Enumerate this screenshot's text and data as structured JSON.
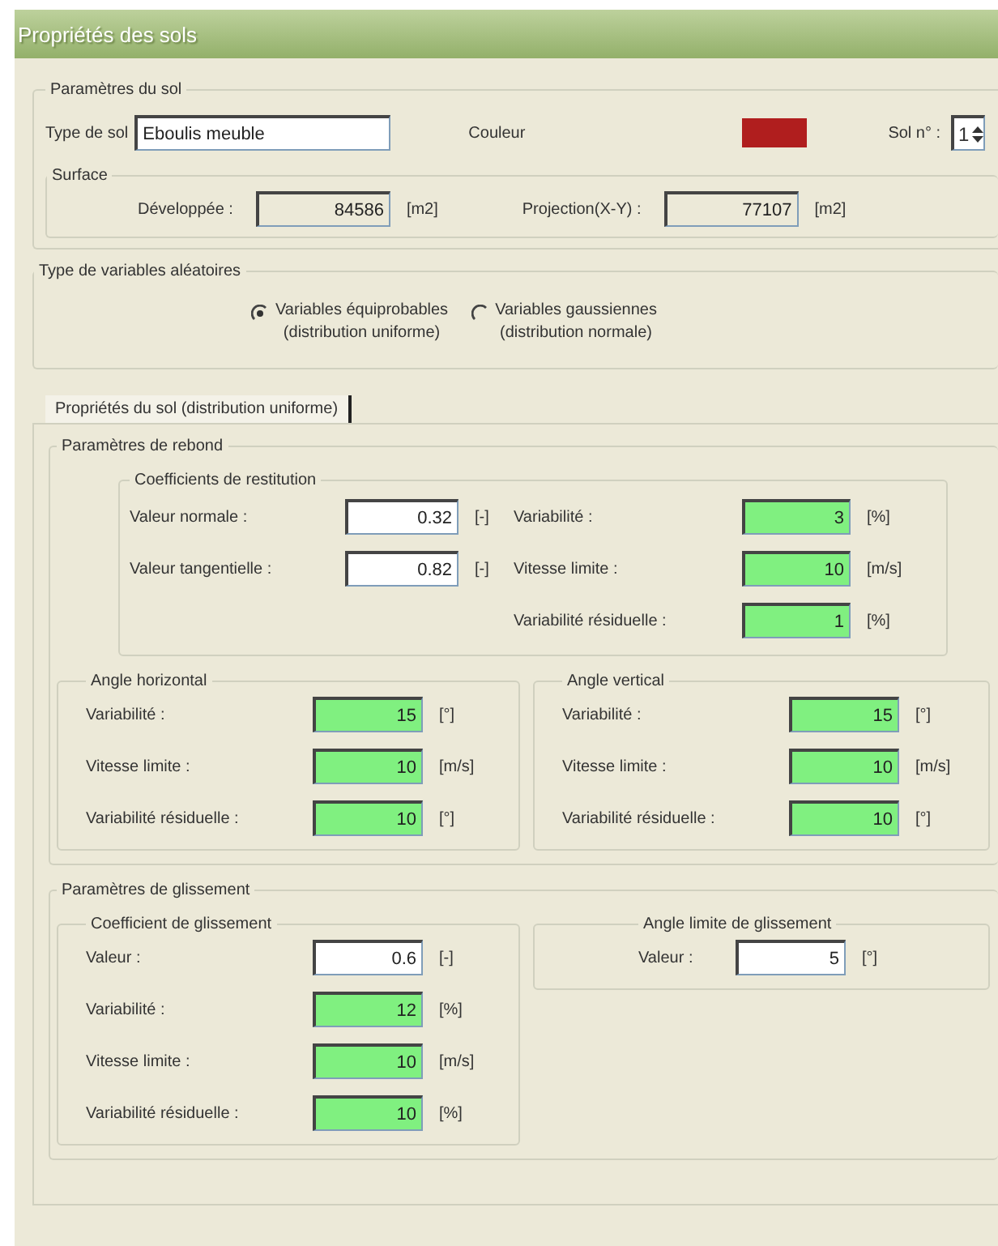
{
  "window": {
    "title": "Propriétés des sols"
  },
  "soil": {
    "legend": "Paramètres du sol",
    "type_label": "Type de sol",
    "type_value": "Eboulis meuble",
    "color_label": "Couleur",
    "color": "#b01e1e",
    "number_label": "Sol n° :",
    "number_value": "1"
  },
  "surface": {
    "legend": "Surface",
    "fields": [
      {
        "label": "Développée :",
        "value": "84586",
        "unit": "[m2]",
        "kind": "readonly"
      },
      {
        "label": "Projection(X-Y) :",
        "value": "77107",
        "unit": "[m2]",
        "kind": "readonly"
      }
    ]
  },
  "random_variables": {
    "legend": "Type de variables aléatoires",
    "options": [
      {
        "lines": [
          "Variables équiprobables",
          "(distribution uniforme)"
        ],
        "selected": true
      },
      {
        "lines": [
          "Variables gaussiennes",
          "(distribution normale)"
        ],
        "selected": false
      }
    ]
  },
  "tabs": [
    {
      "label": "Propriétés du sol (distribution uniforme)",
      "selected": true
    }
  ],
  "rebound": {
    "legend": "Paramètres de rebond",
    "restitution": {
      "legend": "Coefficients de restitution",
      "left": [
        {
          "label": "Valeur normale :",
          "value": "0.32",
          "unit": "[-]",
          "kind": "input"
        },
        {
          "label": "Valeur tangentielle :",
          "value": "0.82",
          "unit": "[-]",
          "kind": "input"
        }
      ],
      "right": [
        {
          "label": "Variabilité :",
          "value": "3",
          "unit": "[%]",
          "kind": "computed"
        },
        {
          "label": "Vitesse limite :",
          "value": "10",
          "unit": "[m/s]",
          "kind": "computed"
        },
        {
          "label": "Variabilité résiduelle :",
          "value": "1",
          "unit": "[%]",
          "kind": "computed"
        }
      ]
    },
    "horizontal": {
      "legend": "Angle horizontal",
      "rows": [
        {
          "label": "Variabilité :",
          "value": "15",
          "unit": "[°]",
          "kind": "computed"
        },
        {
          "label": "Vitesse limite :",
          "value": "10",
          "unit": "[m/s]",
          "kind": "computed"
        },
        {
          "label": "Variabilité résiduelle :",
          "value": "10",
          "unit": "[°]",
          "kind": "computed"
        }
      ]
    },
    "vertical": {
      "legend": "Angle vertical",
      "rows": [
        {
          "label": "Variabilité :",
          "value": "15",
          "unit": "[°]",
          "kind": "computed"
        },
        {
          "label": "Vitesse limite :",
          "value": "10",
          "unit": "[m/s]",
          "kind": "computed"
        },
        {
          "label": "Variabilité résiduelle :",
          "value": "10",
          "unit": "[°]",
          "kind": "computed"
        }
      ]
    }
  },
  "sliding": {
    "legend": "Paramètres de glissement",
    "coefficient": {
      "legend": "Coefficient de glissement",
      "rows": [
        {
          "label": "Valeur :",
          "value": "0.6",
          "unit": "[-]",
          "kind": "input"
        },
        {
          "label": "Variabilité :",
          "value": "12",
          "unit": "[%]",
          "kind": "computed"
        },
        {
          "label": "Vitesse limite :",
          "value": "10",
          "unit": "[m/s]",
          "kind": "computed"
        },
        {
          "label": "Variabilité résiduelle :",
          "value": "10",
          "unit": "[%]",
          "kind": "computed"
        }
      ]
    },
    "angle": {
      "legend": "Angle limite de glissement",
      "rows": [
        {
          "label": "Valeur :",
          "value": "5",
          "unit": "[°]",
          "kind": "input"
        }
      ]
    }
  }
}
